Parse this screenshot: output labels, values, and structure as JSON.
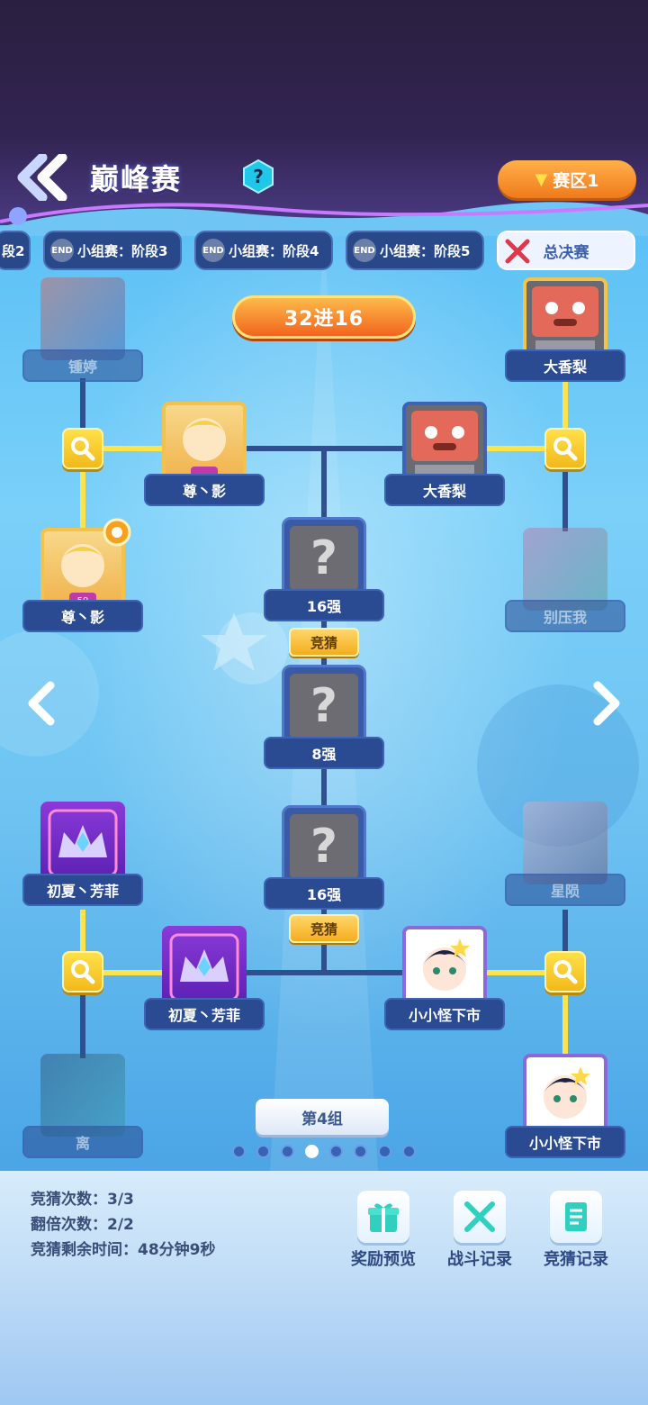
{
  "header": {
    "title": "巅峰赛",
    "help_label": "?",
    "region_label": "赛区1"
  },
  "tabs": [
    {
      "label": "段2",
      "end": false
    },
    {
      "label": "小组赛：阶段3",
      "end": true
    },
    {
      "label": "小组赛：阶段4",
      "end": true
    },
    {
      "label": "小组赛：阶段5",
      "end": true
    },
    {
      "label": "总决赛",
      "end": false,
      "active": true
    }
  ],
  "end_badge": "END",
  "round_label": "32进16",
  "players": {
    "tl_top": "锺婷",
    "tl_mid": "尊丶影",
    "tl_bot": "尊丶影",
    "tr_top": "大香梨",
    "tr_mid": "大香梨",
    "tr_bot": "别压我",
    "bl_top": "初夏丶芳菲",
    "bl_mid": "初夏丶芳菲",
    "bl_bot": "离",
    "br_top": "星陨",
    "br_mid": "小小怪下市",
    "br_bot": "小小怪下市"
  },
  "level_badge": "59",
  "slots": {
    "top16": "16强",
    "top8": "8强",
    "bot16": "16强",
    "unknown": "?"
  },
  "guess_label": "竞猜",
  "group_label": "第4组",
  "pagination": {
    "total": 8,
    "active": 4
  },
  "stats": {
    "guess_count": "竞猜次数：3/3",
    "double_count": "翻倍次数：2/2",
    "time_left": "竞猜剩余时间：48分钟9秒"
  },
  "actions": {
    "rewards": "奖励预览",
    "battle_record": "战斗记录",
    "guess_record": "竞猜记录"
  },
  "colors": {
    "accent_orange": "#f07a1c",
    "bracket_gold": "#ffe34a",
    "bracket_blue": "#2f4f8e"
  }
}
